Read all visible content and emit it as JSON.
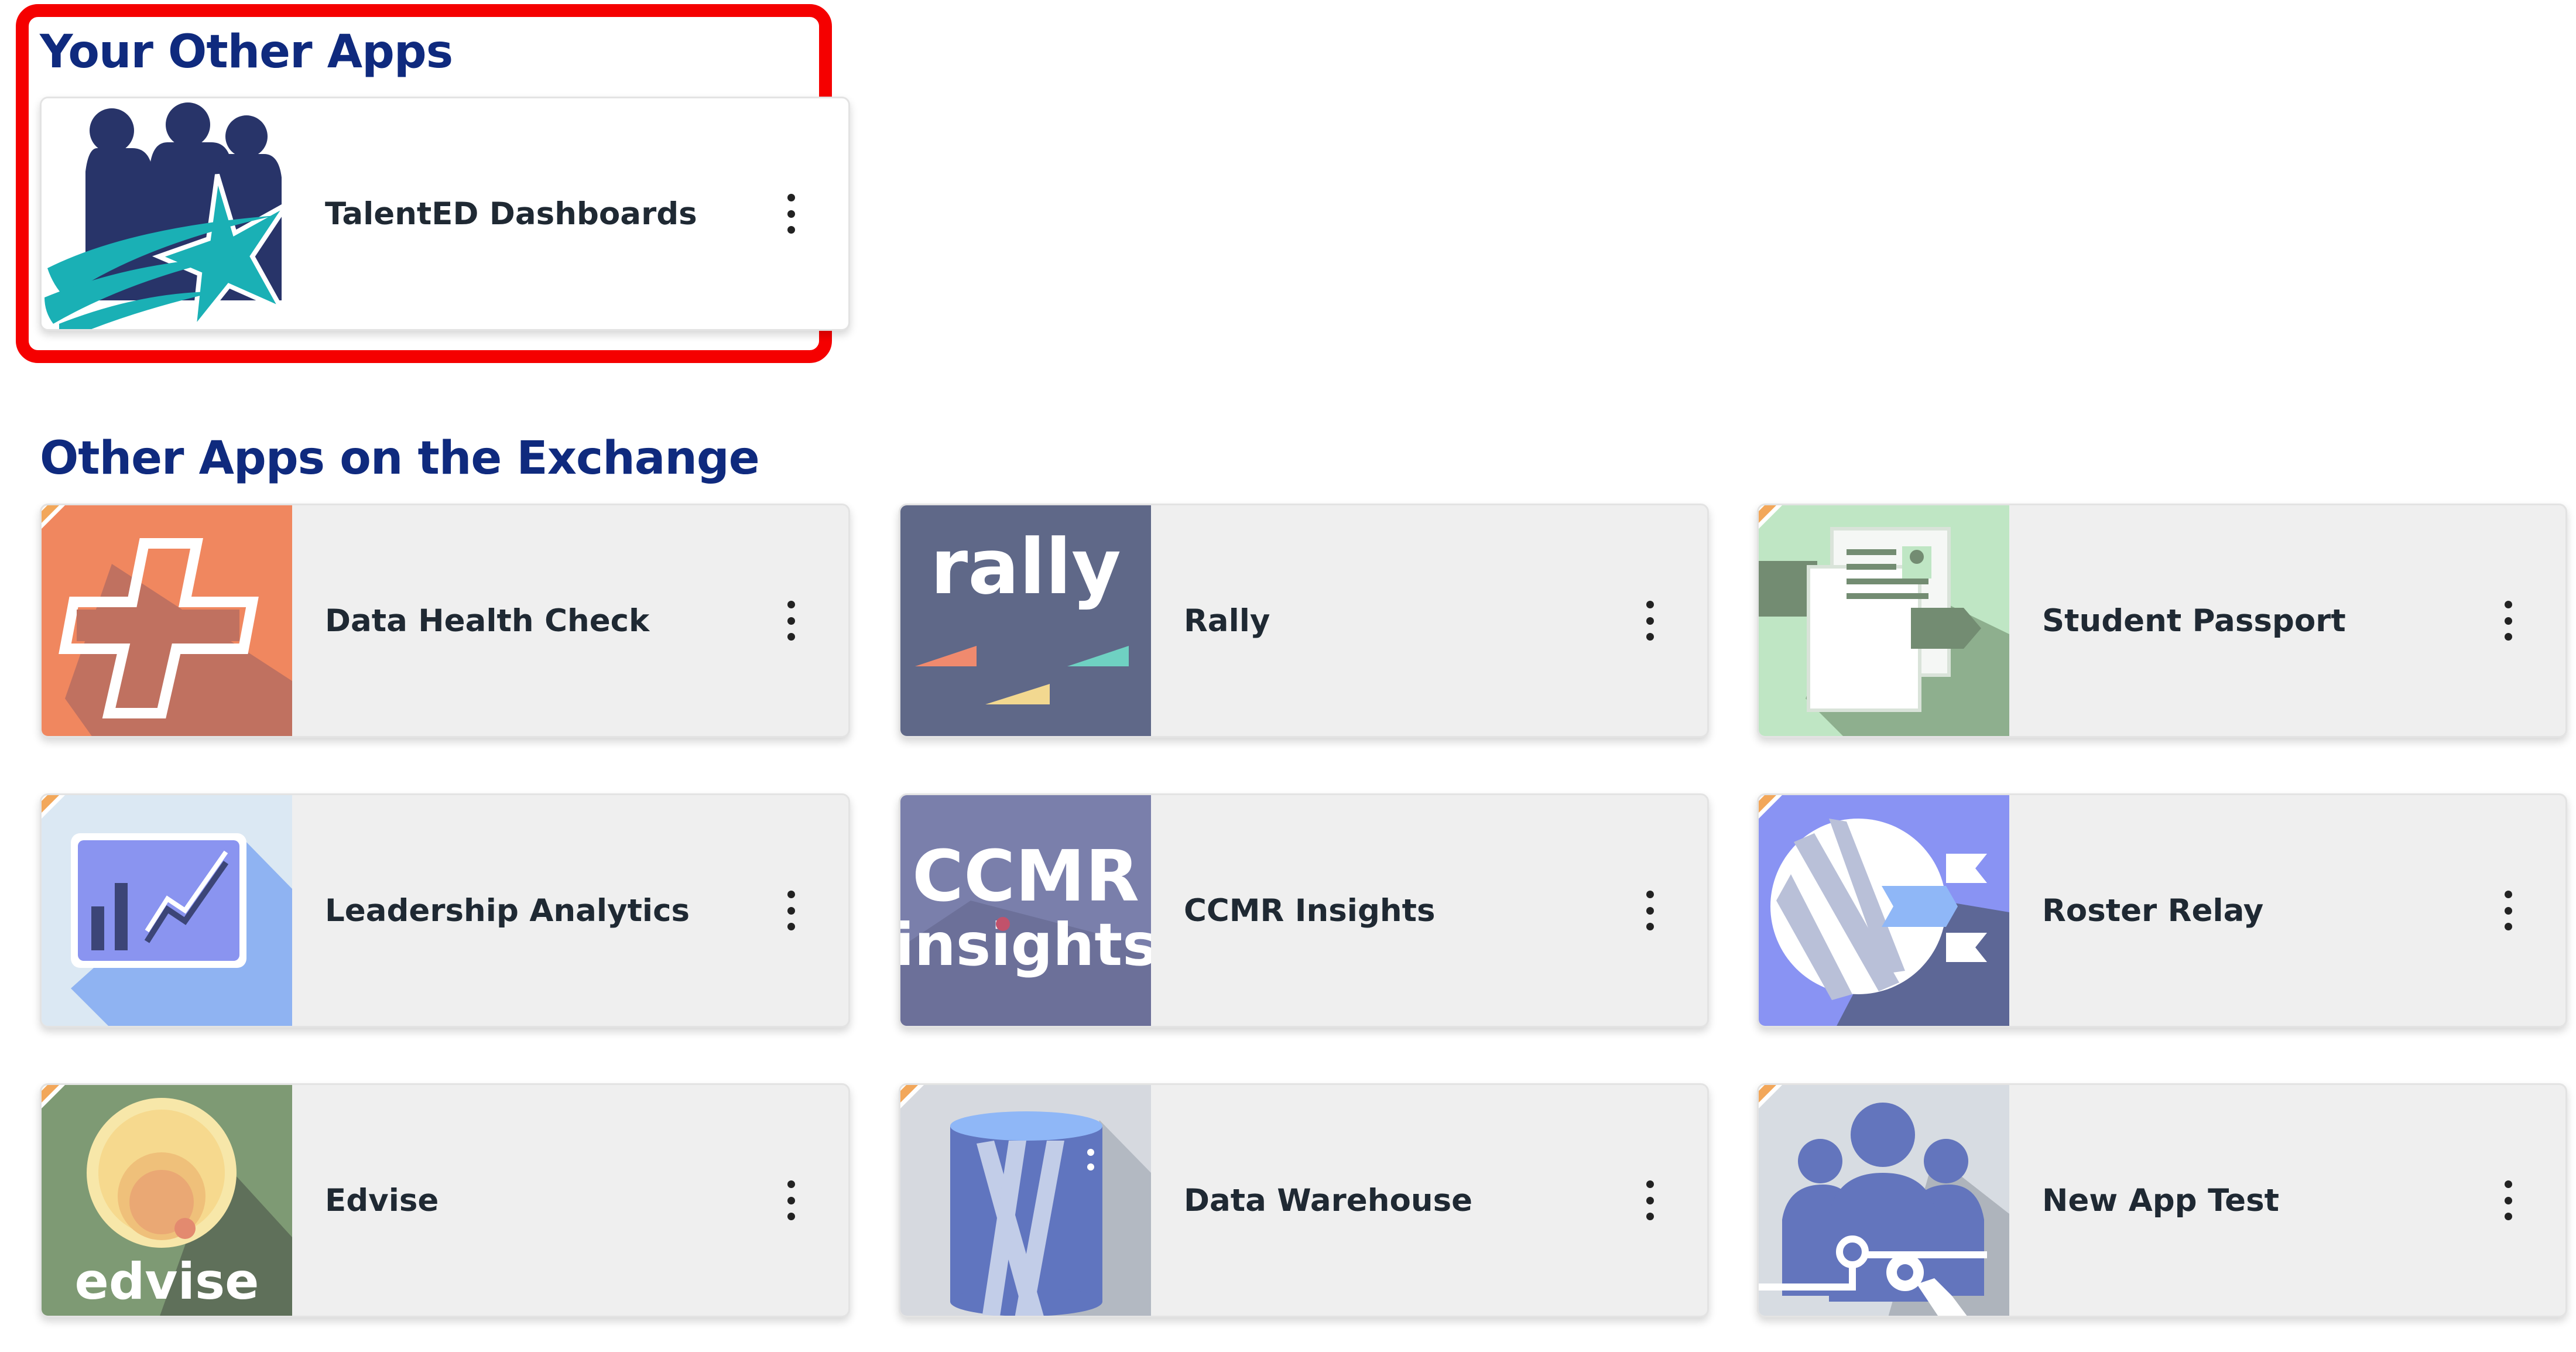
{
  "your_apps": {
    "heading": "Your Other Apps",
    "items": [
      {
        "label": "TalentED Dashboards",
        "icon": "talented-dashboards-logo"
      }
    ]
  },
  "exchange_apps": {
    "heading": "Other Apps on the Exchange",
    "items": [
      {
        "label": "Data Health Check",
        "icon": "health-cross-icon",
        "color": "#f08a5d"
      },
      {
        "label": "Rally",
        "icon": "rally-logo",
        "color": "#5b6484",
        "logo_text": "rally"
      },
      {
        "label": "Student Passport",
        "icon": "passport-document-icon",
        "color": "#bfe3c4"
      },
      {
        "label": "Leadership Analytics",
        "icon": "line-chart-board-icon",
        "color": "#dbe8f3"
      },
      {
        "label": "CCMR Insights",
        "icon": "ccmr-insights-logo",
        "color": "#7a7fab",
        "logo_text_1": "CCMR",
        "logo_text_2": "insights"
      },
      {
        "label": "Roster Relay",
        "icon": "roster-relay-icon",
        "color": "#8b96f2"
      },
      {
        "label": "Edvise",
        "icon": "edvise-logo",
        "color": "#7e9a74",
        "logo_text": "edvise"
      },
      {
        "label": "Data Warehouse",
        "icon": "database-cylinder-icon",
        "color": "#d6d9df"
      },
      {
        "label": "New App Test",
        "icon": "team-settings-icon",
        "color": "#d7dce2"
      }
    ]
  }
}
